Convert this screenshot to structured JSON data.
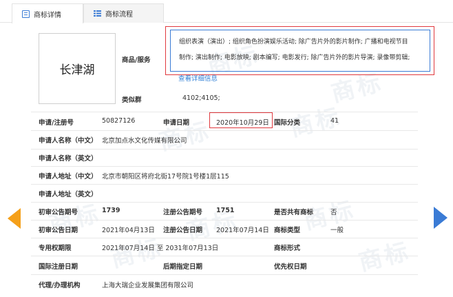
{
  "tabs": [
    {
      "label": "商标详情",
      "icon": "detail-icon",
      "active": true
    },
    {
      "label": "商标流程",
      "icon": "list-icon",
      "active": false
    }
  ],
  "watermark": "商标",
  "trademark": {
    "name": "长津湖"
  },
  "goods": {
    "label": "商品/服务",
    "line1": "组织表演（演出）; 组织角色扮演娱乐活动; 除广告片外的影片制作; 广播和电视节目",
    "line2": "制作; 演出制作; 电影放映; 剧本编写; 电影发行; 除广告片外的影片导演; 录像带剪辑;",
    "more_link": "查看详细信息"
  },
  "similar_group": {
    "label": "类似群",
    "value": "4102;4105;"
  },
  "rows": {
    "reg_no": {
      "label": "申请/注册号",
      "value": "50827126"
    },
    "apply_date": {
      "label": "申请日期",
      "value": "2020年10月29日"
    },
    "intl_class": {
      "label": "国际分类",
      "value": "41"
    },
    "applicant_cn": {
      "label": "申请人名称（中文）",
      "value": "北京加点水文化传媒有限公司"
    },
    "applicant_en": {
      "label": "申请人名称（英文）",
      "value": ""
    },
    "address_cn": {
      "label": "申请人地址（中文）",
      "value": "北京市朝阳区将府北街17号院1号楼1层115"
    },
    "address_en": {
      "label": "申请人地址（英文）",
      "value": ""
    },
    "prelim_no": {
      "label": "初审公告期号",
      "value": "1739"
    },
    "reg_pub_no": {
      "label": "注册公告期号",
      "value": "1751"
    },
    "shared": {
      "label": "是否共有商标",
      "value": "否"
    },
    "prelim_date": {
      "label": "初审公告日期",
      "value": "2021年04月13日"
    },
    "reg_pub_date": {
      "label": "注册公告日期",
      "value": "2021年07月14日"
    },
    "tm_type": {
      "label": "商标类型",
      "value": "一般"
    },
    "exclusive_period": {
      "label": "专用权期限",
      "value": "2021年07月14日 至 2031年07月13日"
    },
    "tm_form": {
      "label": "商标形式",
      "value": ""
    },
    "intl_reg_date": {
      "label": "国际注册日期",
      "value": ""
    },
    "later_date": {
      "label": "后期指定日期",
      "value": ""
    },
    "priority_date": {
      "label": "优先权日期",
      "value": ""
    },
    "agent": {
      "label": "代理/办理机构",
      "value": "上海大瑞企业发展集团有限公司"
    }
  },
  "colors": {
    "accent": "#3a7bd5",
    "highlight": "#e0393e",
    "arrow_prev": "#f5a01a"
  }
}
